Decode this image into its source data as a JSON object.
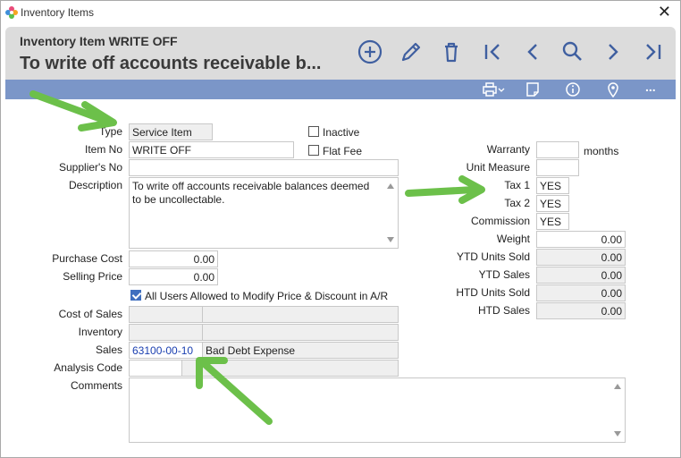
{
  "window": {
    "title": "Inventory Items"
  },
  "header": {
    "subtitle": "Inventory Item WRITE OFF",
    "title": "To write off accounts receivable b..."
  },
  "nav_icons": [
    "add-icon",
    "edit-icon",
    "delete-icon",
    "first-record-icon",
    "previous-record-icon",
    "search-icon",
    "next-record-icon",
    "last-record-icon"
  ],
  "toolbar_icons": [
    "print-icon",
    "notes-icon",
    "info-icon",
    "location-icon",
    "more-icon"
  ],
  "toolbar": {
    "more_label": "..."
  },
  "form": {
    "type": {
      "label": "Type",
      "value": "Service Item"
    },
    "item_no": {
      "label": "Item No",
      "value": "WRITE OFF"
    },
    "suppliers_no": {
      "label": "Supplier's No",
      "value": ""
    },
    "description": {
      "label": "Description",
      "value": "To write off accounts receivable balances deemed to be uncollectable."
    },
    "inactive": {
      "label": "Inactive",
      "checked": false
    },
    "flat_fee": {
      "label": "Flat Fee",
      "checked": false
    },
    "purchase_cost": {
      "label": "Purchase Cost",
      "value": "0.00"
    },
    "selling_price": {
      "label": "Selling Price",
      "value": "0.00"
    },
    "all_users_allowed": {
      "label": "All Users Allowed to Modify Price & Discount in A/R",
      "checked": true
    },
    "cost_of_sales": {
      "label": "Cost of Sales",
      "account": "",
      "name": ""
    },
    "inventory": {
      "label": "Inventory",
      "account": "",
      "name": ""
    },
    "sales": {
      "label": "Sales",
      "account": "63100-00-10",
      "name": "Bad Debt Expense"
    },
    "analysis_code": {
      "label": "Analysis Code",
      "value": "",
      "name": ""
    },
    "comments": {
      "label": "Comments",
      "value": ""
    },
    "warranty": {
      "label": "Warranty",
      "value": "",
      "unit": "months"
    },
    "unit_measure": {
      "label": "Unit Measure",
      "value": ""
    },
    "tax1": {
      "label": "Tax 1",
      "value": "YES"
    },
    "tax2": {
      "label": "Tax 2",
      "value": "YES"
    },
    "commission": {
      "label": "Commission",
      "value": "YES"
    },
    "weight": {
      "label": "Weight",
      "value": "0.00"
    },
    "ytd_units_sold": {
      "label": "YTD Units Sold",
      "value": "0.00"
    },
    "ytd_sales": {
      "label": "YTD Sales",
      "value": "0.00"
    },
    "htd_units_sold": {
      "label": "HTD Units Sold",
      "value": "0.00"
    },
    "htd_sales": {
      "label": "HTD Sales",
      "value": "0.00"
    }
  },
  "colors": {
    "accent": "#3f5fa0",
    "toolbar": "#7b96c8",
    "header_bg": "#dcdcdc",
    "annotation_arrow": "#6cc04a",
    "account_text": "#1a3fb0"
  }
}
